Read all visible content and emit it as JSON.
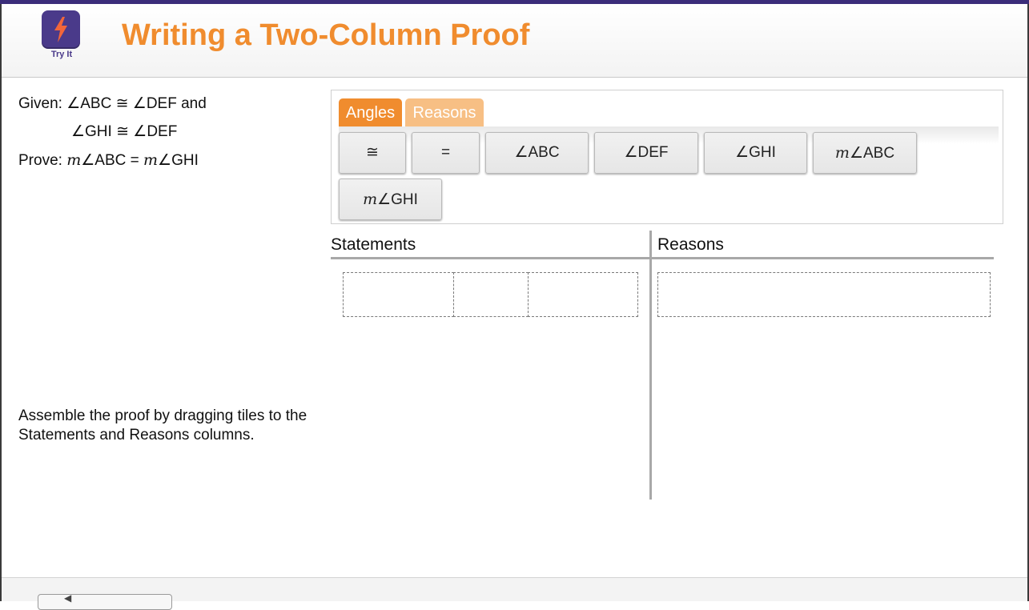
{
  "header": {
    "logo_caption": "Try It",
    "title": "Writing a Two-Column Proof"
  },
  "problem": {
    "given_label": "Given: ",
    "given_line1": "∠ABC ≅ ∠DEF and",
    "given_line2": "∠GHI ≅ ∠DEF",
    "prove_label": "Prove: ",
    "prove_m1": "m",
    "prove_mid": "∠ABC = ",
    "prove_m2": "m",
    "prove_end": "∠GHI",
    "instructions": "Assemble the proof by dragging tiles to the Statements and Reasons columns."
  },
  "tabs": [
    {
      "label": "Angles",
      "active": true
    },
    {
      "label": "Reasons",
      "active": false
    }
  ],
  "tiles": [
    {
      "text": "≅"
    },
    {
      "text": "="
    },
    {
      "text": "∠ABC"
    },
    {
      "text": "∠DEF"
    },
    {
      "text": "∠GHI"
    },
    {
      "m": "m",
      "text": "∠ABC"
    },
    {
      "m": "m",
      "text": "∠GHI"
    }
  ],
  "columns": {
    "statements": "Statements",
    "reasons": "Reasons"
  },
  "colors": {
    "accent": "#f08c2e",
    "accent_light": "#f7bf84",
    "brand": "#4a3a8a",
    "topbar": "#3b2d7a"
  }
}
